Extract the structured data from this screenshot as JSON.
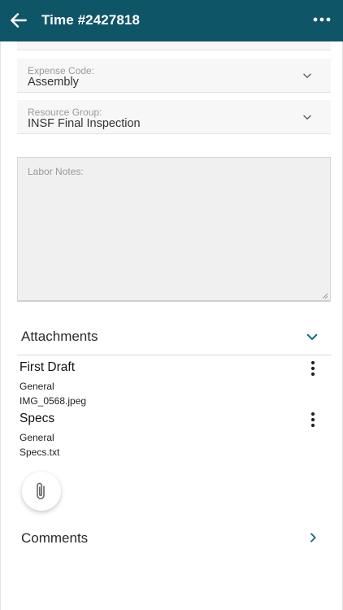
{
  "header": {
    "title": "Time #2427818",
    "back_icon": "arrow-left-icon",
    "menu_icon": "more-horizontal-icon",
    "background": "#0f5568"
  },
  "form": {
    "previous_field_value": "0",
    "expense_code": {
      "label": "Expense Code:",
      "value": "Assembly"
    },
    "resource_group": {
      "label": "Resource Group:",
      "value": "INSF Final Inspection"
    },
    "labor_notes": {
      "placeholder": "Labor Notes:"
    }
  },
  "attachments": {
    "title": "Attachments",
    "items": [
      {
        "name": "First Draft",
        "category": "General",
        "file": "IMG_0568.jpeg"
      },
      {
        "name": "Specs",
        "category": "General",
        "file": "Specs.txt"
      }
    ],
    "add_icon": "paperclip-icon"
  },
  "comments": {
    "title": "Comments"
  },
  "colors": {
    "accent": "#0f5568",
    "icon": "#1b6a80"
  }
}
